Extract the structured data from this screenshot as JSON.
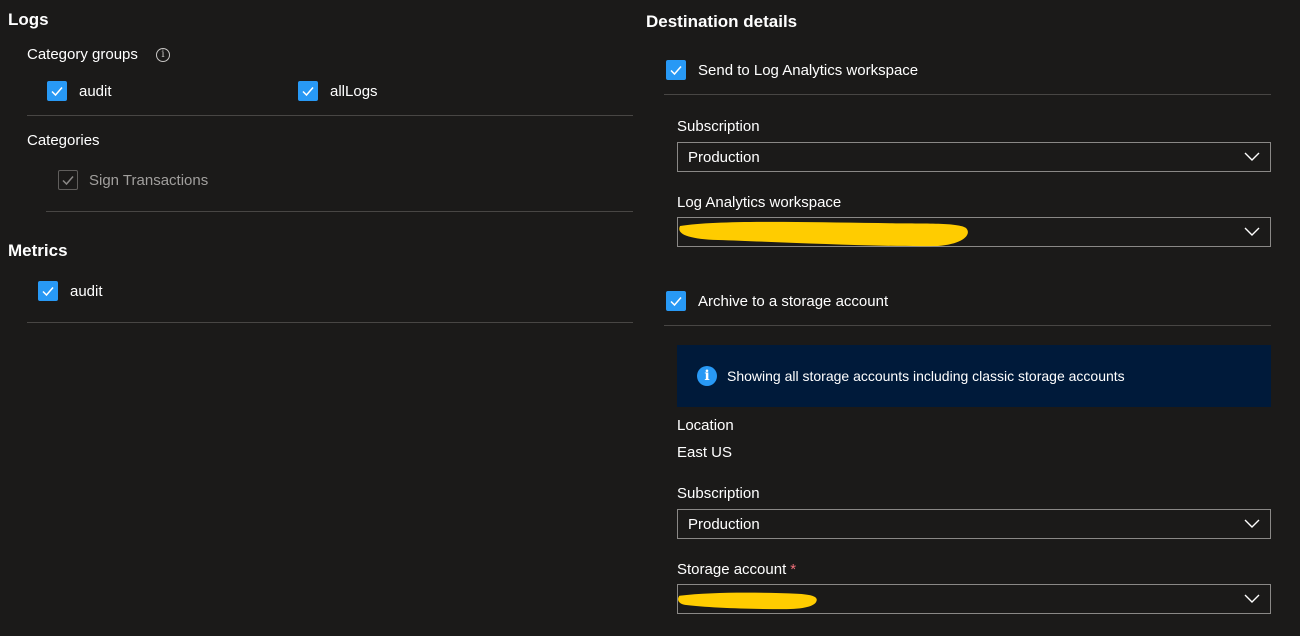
{
  "logs": {
    "title": "Logs",
    "category_groups_label": "Category groups",
    "category_groups": [
      {
        "label": "audit",
        "checked": true
      },
      {
        "label": "allLogs",
        "checked": true
      }
    ],
    "categories_label": "Categories",
    "categories": [
      {
        "label": "Sign Transactions",
        "checked": true,
        "disabled": true
      }
    ]
  },
  "metrics": {
    "title": "Metrics",
    "items": [
      {
        "label": "audit",
        "checked": true
      }
    ]
  },
  "destination": {
    "title": "Destination details",
    "send_to_log_analytics": {
      "label": "Send to Log Analytics workspace",
      "checked": true
    },
    "la_subscription_label": "Subscription",
    "la_subscription_value": "Production",
    "la_workspace_label": "Log Analytics workspace",
    "la_workspace_value": "",
    "archive": {
      "label": "Archive to a storage account",
      "checked": true
    },
    "info_banner": "Showing all storage accounts including classic storage accounts",
    "location_label": "Location",
    "location_value": "East US",
    "sa_subscription_label": "Subscription",
    "sa_subscription_value": "Production",
    "storage_account_label": "Storage account",
    "storage_account_required": "*",
    "storage_account_value": ""
  },
  "colors": {
    "background": "#1b1a19",
    "checkbox_accent": "#2899f5",
    "banner_bg": "#001a3a",
    "redaction": "#ffcc00",
    "required": "#f1707b"
  },
  "icons": [
    "info-icon",
    "checkmark-icon",
    "chevron-down-icon"
  ]
}
